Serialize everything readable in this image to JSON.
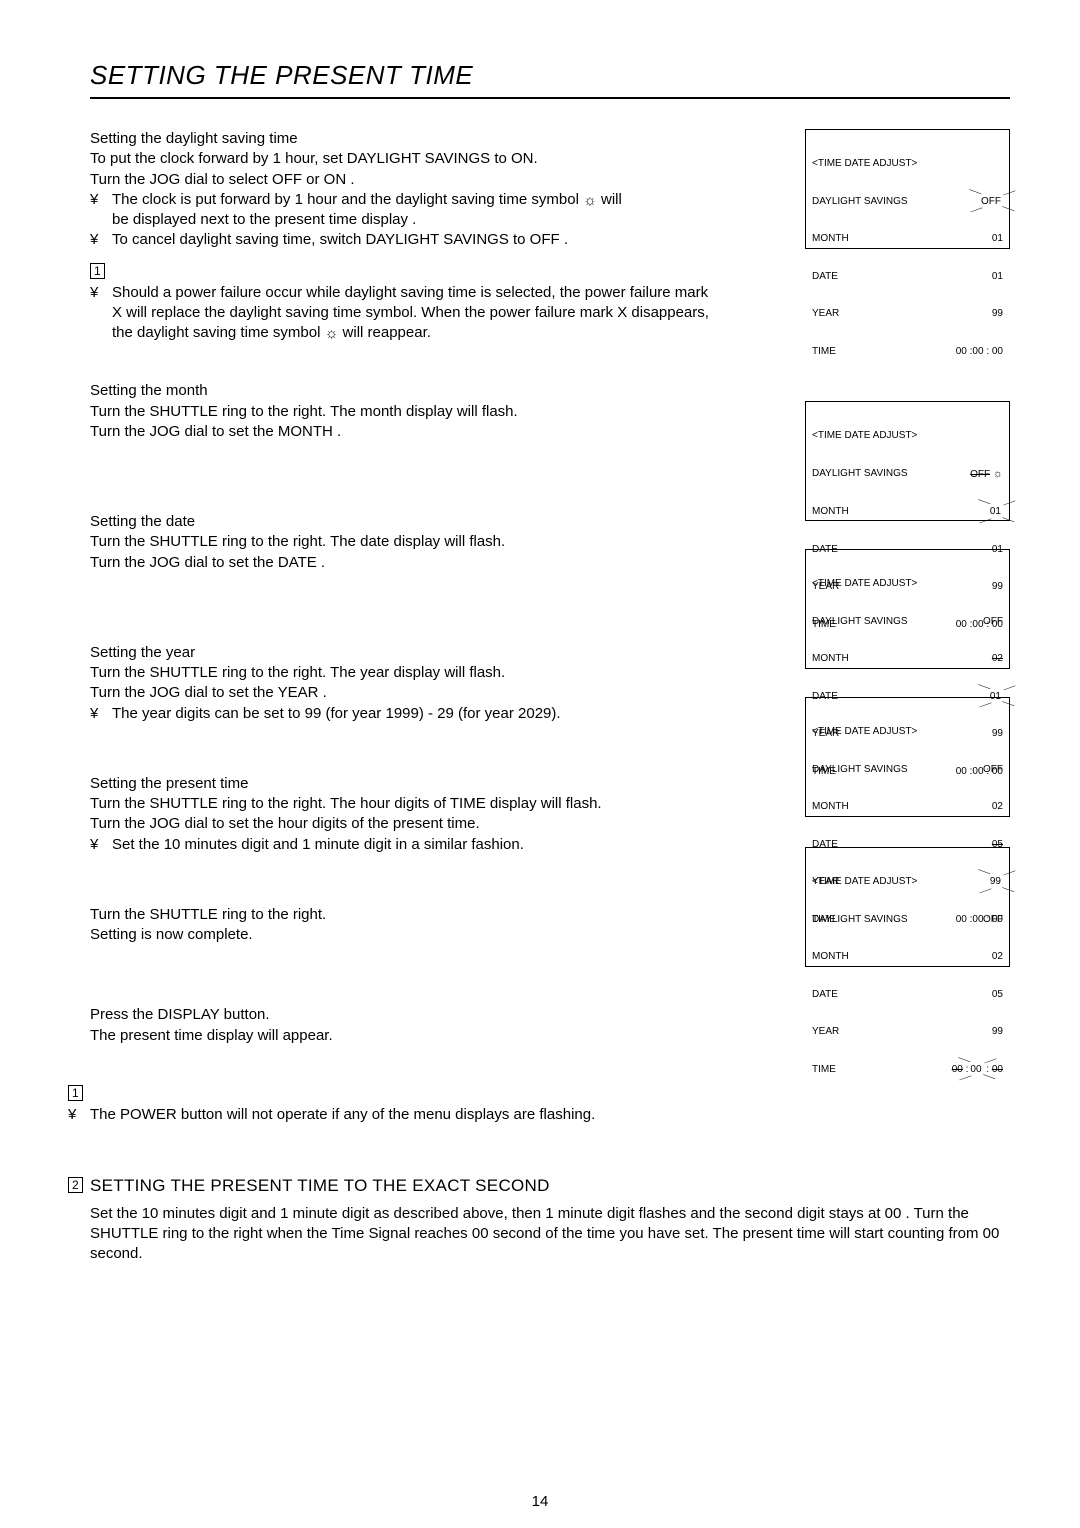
{
  "page_title": "SETTING THE PRESENT TIME",
  "page_number": "14",
  "sections": {
    "daylight": {
      "h": "Setting the daylight saving time",
      "p1": "To put the clock forward by 1 hour, set DAYLIGHT SAVINGS to ON.",
      "p2": "Turn the JOG dial to select  OFF  or  ON .",
      "b1a": "The clock is put forward by 1 hour and the daylight saving time symbol ",
      "b1b": "  will",
      "b1c": "be displayed next to the present time display .",
      "b2": "To cancel daylight saving time, switch  DAYLIGHT SAVINGS  to  OFF .",
      "note_a": "Should a power failure occur while daylight saving time is selected, the power failure mark  X  will replace the daylight saving time symbol.  When the power failure mark  X  disappears, the daylight saving time symbol ",
      "note_b": "  will reappear."
    },
    "month": {
      "h": "Setting the month",
      "p1": "Turn the SHUTTLE ring to the right.  The month display will flash.",
      "p2": "Turn the JOG dial to set the  MONTH ."
    },
    "date": {
      "h": "Setting the date",
      "p1": "Turn the SHUTTLE ring to the right.  The date display will flash.",
      "p2": "Turn the JOG dial to set the  DATE ."
    },
    "year": {
      "h": "Setting the year",
      "p1": "Turn the SHUTTLE ring to the right.  The year display will flash.",
      "p2": "Turn the JOG dial to set the  YEAR .",
      "b1": "The year digits can be set to 99 (for year 1999) - 29 (for year 2029)."
    },
    "time": {
      "h": "Setting the present time",
      "p1": "Turn the SHUTTLE ring to the right.  The hour digits of  TIME  display will flash.",
      "p2": "Turn the JOG dial to set the hour digits of the present time.",
      "b1": "Set the 10 minutes digit and 1 minute digit in a similar fashion."
    },
    "complete": {
      "p1": "Turn the SHUTTLE ring to the right.",
      "p2": "Setting is now complete."
    },
    "display": {
      "p1": "Press the DISPLAY button.",
      "p2": "The present time display will appear."
    },
    "power_note": "The POWER button will not operate if any of the menu displays are flashing.",
    "exact": {
      "h": "SETTING THE PRESENT TIME TO THE EXACT SECOND",
      "p": "Set the 10 minutes digit and 1 minute digit as described above, then 1 minute digit flashes and the second digit stays at  00 .  Turn the SHUTTLE ring to the right when the Time Signal reaches 00 second of the time you have set.  The present time will start counting from 00 second."
    }
  },
  "bullet_symbol": "¥",
  "marker1": "1",
  "marker2": "2",
  "sun_glyph": "☼",
  "screens": {
    "header": "<TIME DATE ADJUST>",
    "labels": {
      "ds": "DAYLIGHT SAVINGS",
      "month": "MONTH",
      "date": "DATE",
      "year": "YEAR",
      "time": "TIME"
    },
    "s1": {
      "ds": "OFF",
      "month": "01",
      "date": "01",
      "year": "99",
      "time": "00 :00 : 00"
    },
    "s2": {
      "ds": "OFF",
      "month": "01",
      "date": "01",
      "year": "99",
      "time": "00 :00 : 00"
    },
    "s3": {
      "ds": "OFF",
      "month": "02",
      "date": "01",
      "year": "99",
      "time": "00 :00 : 00"
    },
    "s4": {
      "ds": "OFF",
      "month": "02",
      "date": "05",
      "year": "99",
      "time": "00 :00 : 00"
    },
    "s5": {
      "ds": "OFF",
      "month": "02",
      "date": "05",
      "year": "99",
      "time": "00 :00 : 00"
    }
  }
}
